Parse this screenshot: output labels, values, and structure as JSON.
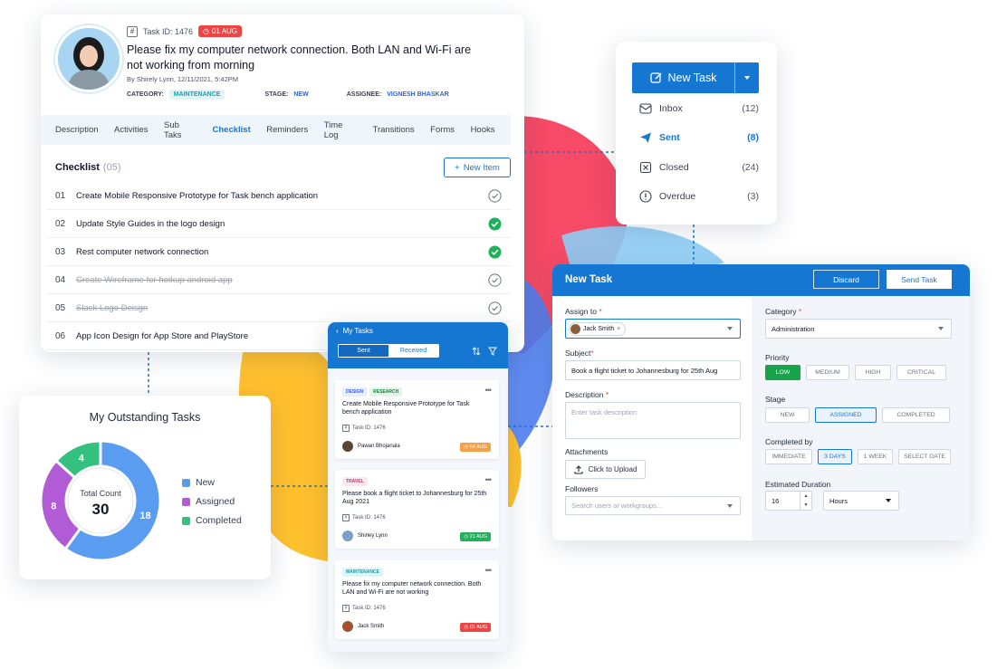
{
  "task": {
    "task_id_label": "Task ID: 1476",
    "due_badge": "01 AUG",
    "title": "Please fix my computer network connection. Both LAN and Wi-Fi are not working from morning",
    "by_line": "By Shirely Lynn, 12/11/2021, 5:42PM",
    "category_label": "CATEGORY:",
    "category_value": "MAINTENANCE",
    "stage_label": "STAGE:",
    "stage_value": "NEW",
    "assignee_label": "ASSIGNEE:",
    "assignee_value": "VIGNESH BHASKAR",
    "tabs": [
      "Description",
      "Activities",
      "Sub Taks",
      "Checklist",
      "Reminders",
      "Time Log",
      "Transitions",
      "Forms",
      "Hooks"
    ],
    "active_tab": "Checklist",
    "checklist_title": "Checklist",
    "checklist_count": "(05)",
    "new_item_label": "New Item",
    "checklist": [
      {
        "num": "01",
        "text": "Create Mobile Responsive Prototype for Task bench application",
        "status": "open"
      },
      {
        "num": "02",
        "text": "Update Style Guides in the logo design",
        "status": "done"
      },
      {
        "num": "03",
        "text": "Rest computer network connection",
        "status": "done"
      },
      {
        "num": "04",
        "text": "Create Wireframe for hotkup android app",
        "status": "struck"
      },
      {
        "num": "05",
        "text": "Slack Logo Deisgn",
        "status": "struck"
      },
      {
        "num": "06",
        "text": "App Icon Design for App Store and PlayStore",
        "status": "open"
      }
    ]
  },
  "inbox": {
    "new_task_label": "New Task",
    "folders": [
      {
        "label": "Inbox",
        "count": "(12)",
        "icon": "inbox-icon"
      },
      {
        "label": "Sent",
        "count": "(8)",
        "icon": "send-icon"
      },
      {
        "label": "Closed",
        "count": "(24)",
        "icon": "closed-icon"
      },
      {
        "label": "Overdue",
        "count": "(3)",
        "icon": "overdue-icon"
      }
    ],
    "active": "Sent"
  },
  "form": {
    "title": "New Task",
    "discard_label": "Discard",
    "send_label": "Send Task",
    "assign_label": "Assign to",
    "assign_chip": "Jack Smith",
    "subject_label": "Subject",
    "subject_value": "Book a flight ticket to Johannesburg for 25th Aug",
    "description_label": "Description",
    "description_placeholder": "Enter task description",
    "attachments_label": "Attachments",
    "upload_label": "Click to Upload",
    "followers_label": "Followers",
    "followers_placeholder": "Search users or workgroups...",
    "category_label": "Category",
    "category_value": "Administration",
    "priority_label": "Priority",
    "priority_options": [
      "LOW",
      "MEDIUM",
      "HIGH",
      "CRITICAL"
    ],
    "priority_selected": "LOW",
    "stage_label": "Stage",
    "stage_options": [
      "NEW",
      "ASSIGNED",
      "COMPLETED"
    ],
    "stage_selected": "ASSIGNED",
    "completed_by_label": "Completed by",
    "completed_by_options": [
      "IMMEDIATE",
      "3 DAYS",
      "1 WEEK",
      "SELECT DATE"
    ],
    "completed_by_selected": "3 DAYS",
    "duration_label": "Estimated Duration",
    "duration_value": "16",
    "duration_unit": "Hours"
  },
  "mobile": {
    "title": "My Tasks",
    "segments": [
      "Sent",
      "Received"
    ],
    "active_segment": "Received",
    "cards": [
      {
        "tags": [
          "DESIGN",
          "RESEARCH"
        ],
        "title": "Create Mobile Responsive Prototype for Task bench application",
        "task_id": "Task ID: 1476",
        "user": "Pawan Bhojanala",
        "due": "04 AUG",
        "due_color": "#f5a14a"
      },
      {
        "tags": [
          "TRAVEL"
        ],
        "title": "Please book a flight ticket to Johannesburg for 25th Aug 2021",
        "task_id": "Task ID: 1476",
        "user": "Shirley Lynn",
        "due": "21 AUG",
        "due_color": "#22b05c"
      },
      {
        "tags": [
          "MAINTENANCE"
        ],
        "title": "Please fix my computer network connection. Both LAN and Wi-Fi are not working",
        "task_id": "Task ID: 1476",
        "user": "Jack Smith",
        "due": "01 AUG",
        "due_color": "#ef4444"
      }
    ]
  },
  "outstanding": {
    "title": "My Outstanding Tasks",
    "center_label": "Total Count",
    "center_value": "30",
    "chart_data": {
      "type": "pie",
      "categories": [
        "New",
        "Assigned",
        "Completed"
      ],
      "values": [
        18,
        8,
        4
      ],
      "colors": [
        "#5a9cf0",
        "#b25bd6",
        "#34c17f"
      ]
    }
  },
  "colors": {
    "accent": "#1677d2",
    "success": "#22b05c",
    "danger": "#ef4444"
  }
}
